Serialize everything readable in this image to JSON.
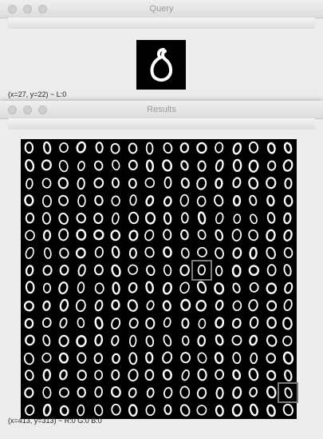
{
  "query_window": {
    "title": "Query",
    "status": "(x=27, y=22) ~ L:0",
    "image": {
      "label": "handwritten digit zero"
    }
  },
  "results_window": {
    "title": "Results",
    "status": "(x=413, y=313) ~ R:0 G:0 B:0",
    "grid": {
      "rows": 16,
      "cols": 16,
      "digit": "0",
      "digit_color": "#ffffff",
      "background": "#000000"
    },
    "highlighted_cells": [
      {
        "row": 7,
        "col": 10
      },
      {
        "row": 14,
        "col": 15
      }
    ]
  },
  "colors": {
    "window_bg": "#ececec",
    "title_text": "#9a9a9a",
    "highlight_border": "#7d7d7d"
  }
}
